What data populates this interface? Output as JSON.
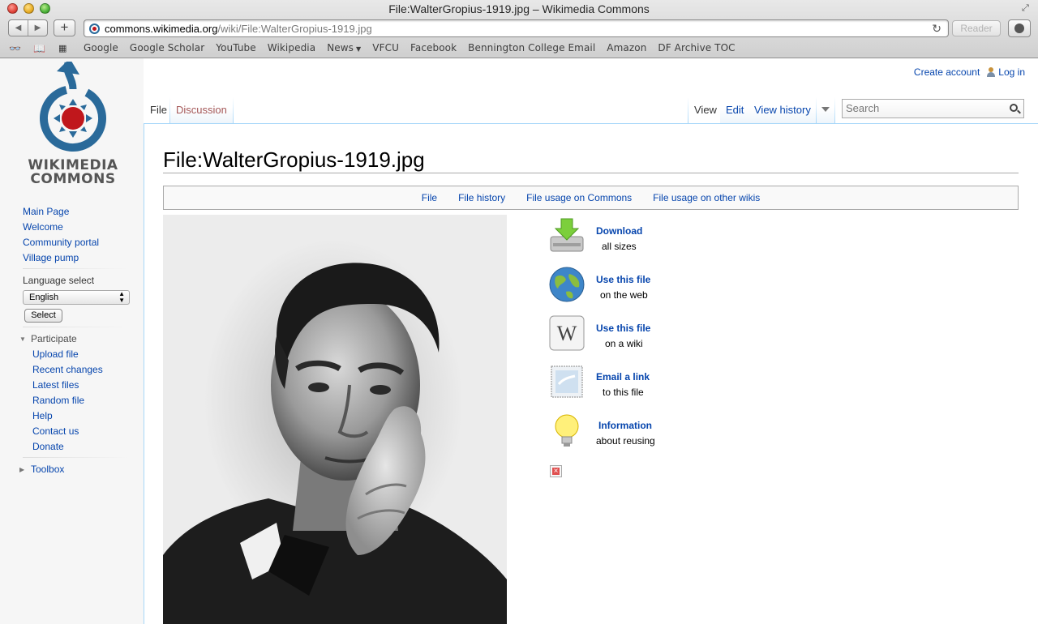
{
  "window": {
    "title": "File:WalterGropius-1919.jpg – Wikimedia Commons"
  },
  "address_bar": {
    "host": "commons.wikimedia.org",
    "path": "/wiki/File:WalterGropius-1919.jpg",
    "reader_label": "Reader"
  },
  "bookmarks": {
    "items": [
      "Google",
      "Google Scholar",
      "YouTube",
      "Wikipedia",
      "News",
      "VFCU",
      "Facebook",
      "Bennington College Email",
      "Amazon",
      "DF Archive TOC"
    ]
  },
  "logo": {
    "line1": "WIKIMEDIA",
    "line2": "COMMONS"
  },
  "sidebar": {
    "nav": [
      "Main Page",
      "Welcome",
      "Community portal",
      "Village pump"
    ],
    "language_label": "Language select",
    "language_value": "English",
    "select_button": "Select",
    "participate_label": "Participate",
    "participate": [
      "Upload file",
      "Recent changes",
      "Latest files",
      "Random file",
      "Help",
      "Contact us",
      "Donate"
    ],
    "toolbox_label": "Toolbox"
  },
  "personal": {
    "create_account": "Create account",
    "log_in": "Log in"
  },
  "tabs": {
    "file": "File",
    "discussion": "Discussion",
    "view": "View",
    "edit": "Edit",
    "view_history": "View history"
  },
  "search": {
    "placeholder": "Search"
  },
  "page": {
    "title": "File:WalterGropius-1919.jpg"
  },
  "file_toc": [
    "File",
    "File history",
    "File usage on Commons",
    "File usage on other wikis"
  ],
  "actions": [
    {
      "title": "Download",
      "sub": "all sizes",
      "icon": "download-icon"
    },
    {
      "title": "Use this file",
      "sub": "on the web",
      "icon": "globe-icon"
    },
    {
      "title": "Use this file",
      "sub": "on a wiki",
      "icon": "wikipedia-icon"
    },
    {
      "title": "Email a link",
      "sub": "to this file",
      "icon": "email-icon"
    },
    {
      "title": "Information",
      "sub": "about reusing",
      "icon": "lightbulb-icon"
    }
  ],
  "colors": {
    "link": "#0645ad",
    "discussion": "#a55858",
    "logo_blue": "#2a6a9a",
    "logo_red": "#c0171c"
  }
}
